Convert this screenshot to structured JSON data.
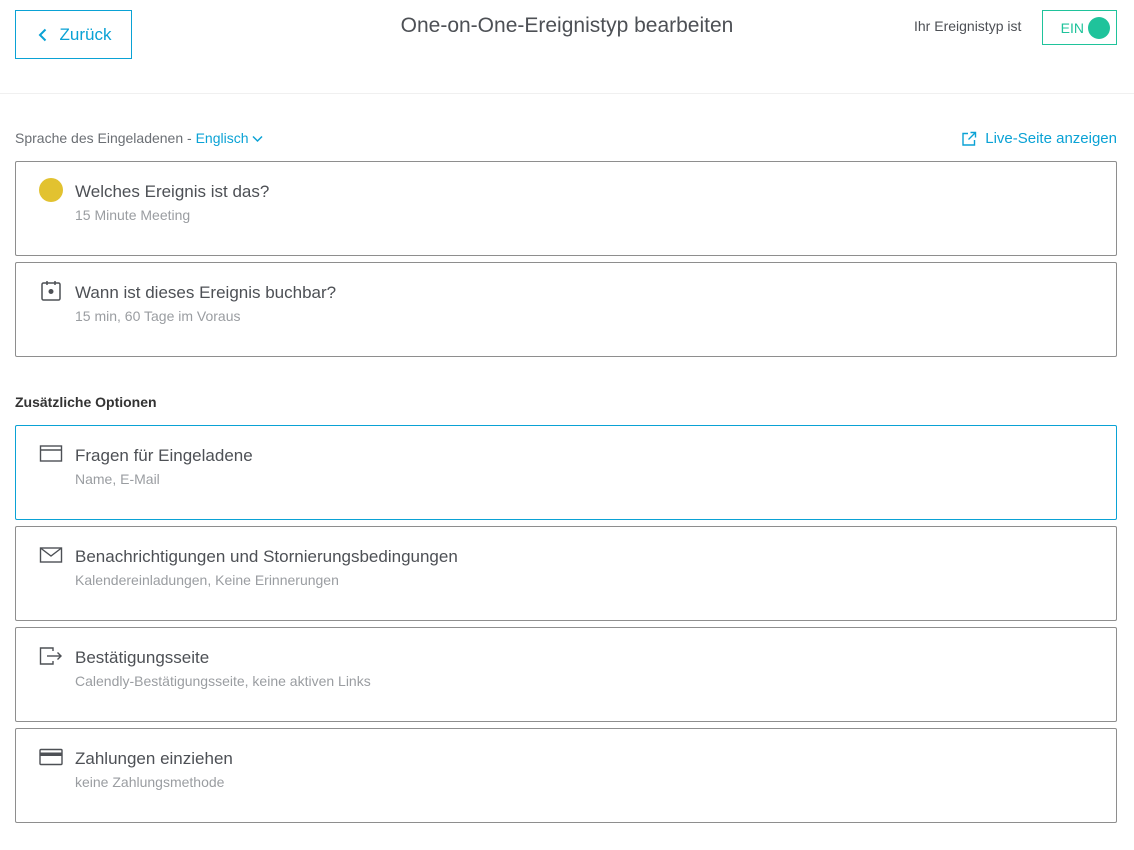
{
  "header": {
    "back_label": "Zurück",
    "title": "One-on-One-Ereignistyp bearbeiten",
    "status_label": "Ihr Ereignistyp ist",
    "toggle_label": "EIN"
  },
  "language": {
    "prefix": "Sprache des Eingeladenen - ",
    "value": "Englisch"
  },
  "live_link": "Live-Seite anzeigen",
  "main_cards": [
    {
      "title": "Welches Ereignis ist das?",
      "subtitle": "15 Minute Meeting",
      "icon": "yellow-dot-icon"
    },
    {
      "title": "Wann ist dieses Ereignis buchbar?",
      "subtitle": "15 min, 60 Tage im Voraus",
      "icon": "calendar-icon"
    }
  ],
  "additional_options": {
    "title": "Zusätzliche Optionen",
    "cards": [
      {
        "title": "Fragen für Eingeladene",
        "subtitle": "Name, E-Mail",
        "icon": "form-icon"
      },
      {
        "title": "Benachrichtigungen und Stornierungsbedingungen",
        "subtitle": "Kalendereinladungen, Keine Erinnerungen",
        "icon": "envelope-icon"
      },
      {
        "title": "Bestätigungsseite",
        "subtitle": "Calendly-Bestätigungsseite, keine aktiven Links",
        "icon": "exit-arrow-icon"
      },
      {
        "title": "Zahlungen einziehen",
        "subtitle": "keine Zahlungsmethode",
        "icon": "credit-card-icon"
      }
    ]
  },
  "colors": {
    "accent": "#0aa2d5",
    "toggle_on": "#1fc39b",
    "event_dot": "#e2c230"
  }
}
